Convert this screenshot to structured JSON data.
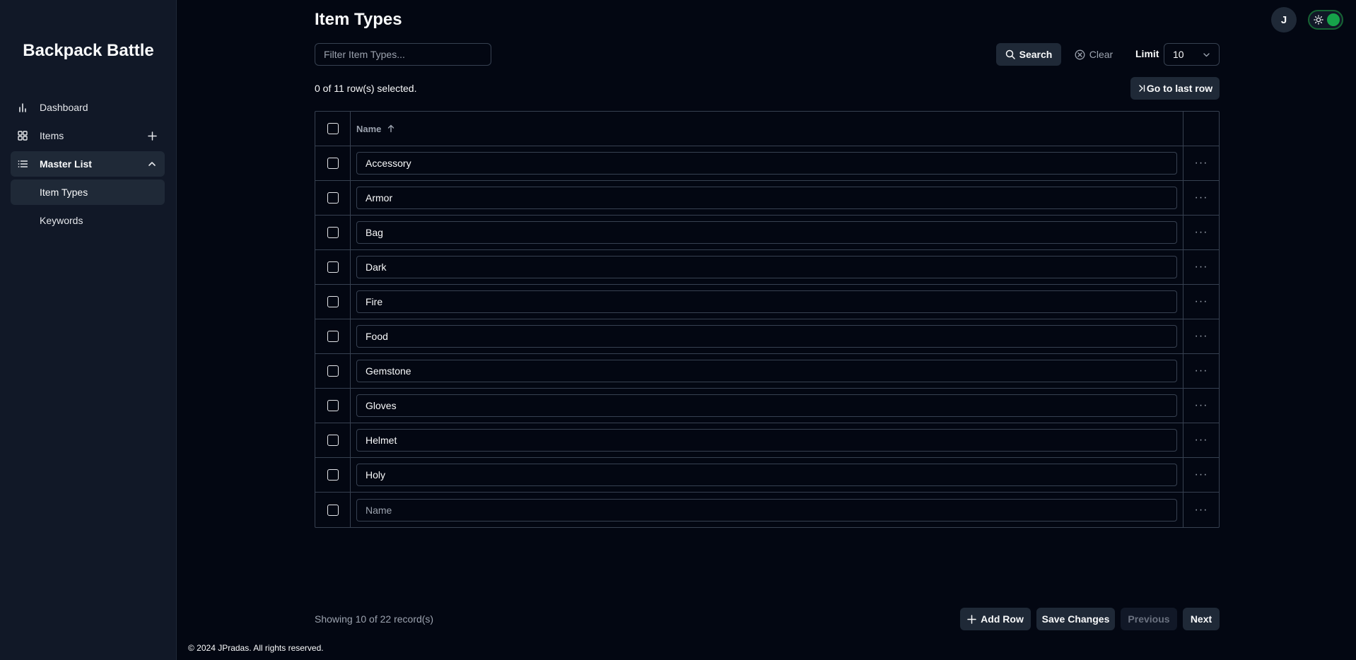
{
  "brand": "Backpack Battle",
  "sidebar": {
    "items": [
      {
        "label": "Dashboard"
      },
      {
        "label": "Items"
      },
      {
        "label": "Master List"
      }
    ],
    "sub_items": [
      {
        "label": "Item Types"
      },
      {
        "label": "Keywords"
      }
    ]
  },
  "header": {
    "title": "Item Types",
    "avatar_initial": "J"
  },
  "toolbar": {
    "filter_placeholder": "Filter Item Types...",
    "search_label": "Search",
    "clear_label": "Clear",
    "limit_label": "Limit",
    "limit_value": "10",
    "selection_status": "0 of 11 row(s) selected.",
    "go_last_label": "Go to last row"
  },
  "table": {
    "column_name": "Name",
    "rows": [
      "Accessory",
      "Armor",
      "Bag",
      "Dark",
      "Fire",
      "Food",
      "Gemstone",
      "Gloves",
      "Helmet",
      "Holy"
    ],
    "new_row_placeholder": "Name"
  },
  "pagination": {
    "showing": "Showing 10 of 22 record(s)",
    "add_row_label": "Add Row",
    "save_label": "Save Changes",
    "previous_label": "Previous",
    "next_label": "Next"
  },
  "footer": "© 2024 JPradas. All rights reserved.",
  "colors": {
    "background": "#030712",
    "sidebar": "#111827",
    "accent_toggle": "#16a34a"
  }
}
